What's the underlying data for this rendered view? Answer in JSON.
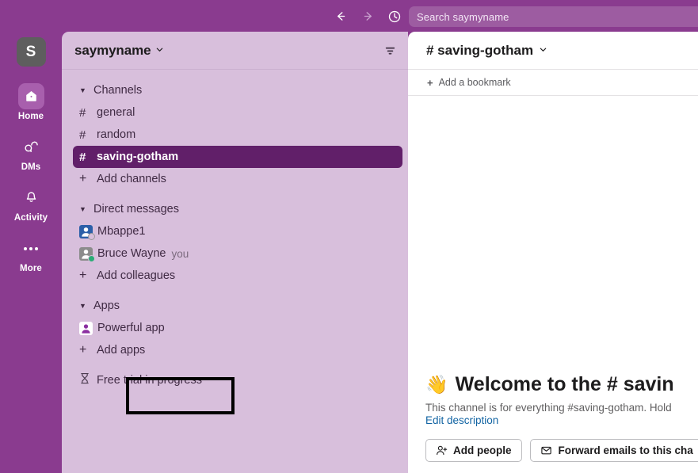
{
  "topbar": {
    "back_icon": "arrow-left-icon",
    "forward_icon": "arrow-right-icon",
    "history_icon": "clock-icon",
    "search_placeholder": "Search saymyname"
  },
  "rail": {
    "workspace_initial": "S",
    "items": [
      {
        "label": "Home",
        "icon": "home-icon",
        "active": true
      },
      {
        "label": "DMs",
        "icon": "dms-icon",
        "active": false
      },
      {
        "label": "Activity",
        "icon": "bell-icon",
        "active": false
      },
      {
        "label": "More",
        "icon": "ellipsis-icon",
        "active": false
      }
    ]
  },
  "sidebar": {
    "workspace_name": "saymyname",
    "workspace_caret": "⌄",
    "filter_icon": "filter-icon",
    "sections": {
      "channels": {
        "label": "Channels",
        "items": [
          {
            "label": "general",
            "active": false
          },
          {
            "label": "random",
            "active": false
          },
          {
            "label": "saving-gotham",
            "active": true
          }
        ],
        "add_label": "Add channels"
      },
      "direct_messages": {
        "label": "Direct messages",
        "items": [
          {
            "label": "Mbappe1",
            "you": "",
            "avatar_color": "#2c5fa8",
            "presence_color": "#9b9b9b"
          },
          {
            "label": "Bruce Wayne",
            "you": "you",
            "avatar_color": "#8c8c8c",
            "presence_color": "#2bac76"
          }
        ],
        "add_label": "Add colleagues"
      },
      "apps": {
        "label": "Apps",
        "items": [
          {
            "label": "Powerful app",
            "avatar_color": "#8b2fa0"
          }
        ],
        "add_label": "Add apps"
      }
    },
    "free_trial": "Free trial in progress"
  },
  "main": {
    "channel_name": "# saving-gotham",
    "channel_caret": "⌄",
    "bookmark_label": "Add a bookmark",
    "welcome_emoji": "👋",
    "welcome_title": "Welcome to the # savin",
    "welcome_desc": "This channel is for everything #saving-gotham. Hold",
    "edit_description": "Edit description",
    "buttons": [
      {
        "label": "Add people",
        "icon": "person-add-icon"
      },
      {
        "label": "Forward emails to this cha",
        "icon": "envelope-icon"
      }
    ]
  },
  "colors": {
    "brand_purple": "#8a3b8f",
    "sidebar_bg": "#d8bfdc",
    "active_channel": "#611f69",
    "link_blue": "#1264a3",
    "highlight_box": "#000000"
  }
}
